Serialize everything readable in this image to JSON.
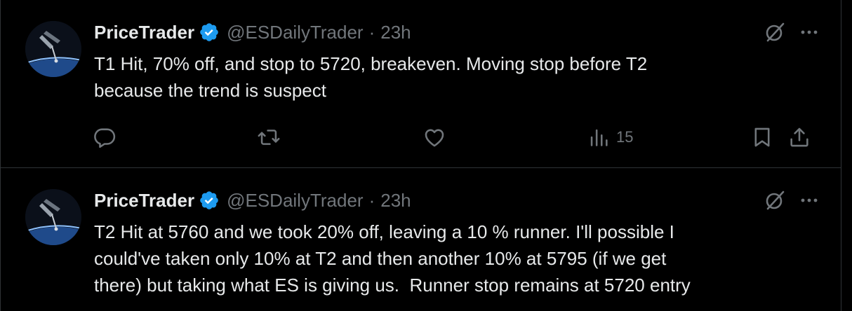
{
  "colors": {
    "background": "#000000",
    "text_primary": "#e7e9ea",
    "text_secondary": "#71767b",
    "divider": "#2f3336",
    "verified_badge": "#1d9bf0"
  },
  "tweets": [
    {
      "author": {
        "display_name": "PriceTrader",
        "handle": "@ESDailyTrader",
        "verified": true
      },
      "separator": "·",
      "time": "23h",
      "text": "T1 Hit, 70% off, and stop to 5720, breakeven. Moving stop before T2\nbecause the trend is suspect",
      "stats": {
        "views": "15"
      },
      "icons": {
        "grok": "grok-icon",
        "more": "more-dots-icon",
        "reply": "reply-icon",
        "retweet": "retweet-icon",
        "like": "heart-icon",
        "views": "views-chart-icon",
        "bookmark": "bookmark-icon",
        "share": "share-icon"
      }
    },
    {
      "author": {
        "display_name": "PriceTrader",
        "handle": "@ESDailyTrader",
        "verified": true
      },
      "separator": "·",
      "time": "23h",
      "text": "T2 Hit at 5760 and we took 20% off, leaving a 10 % runner. I'll possible I\ncould've taken only 10% at T2 and then another 10% at 5795 (if we get\nthere) but taking what ES is giving us.  Runner stop remains at 5720 entry",
      "icons": {
        "grok": "grok-icon",
        "more": "more-dots-icon"
      }
    }
  ]
}
